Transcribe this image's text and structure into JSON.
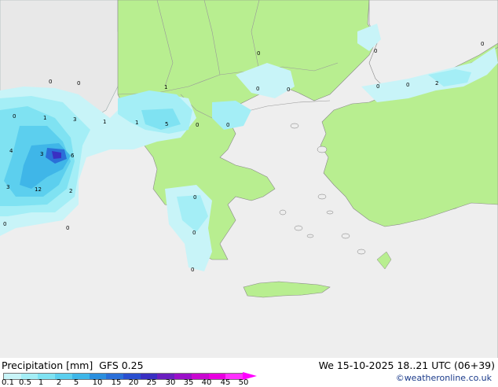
{
  "footer": {
    "title": "Precipitation [mm]  GFS 0.25",
    "valid_time": "We 15-10-2025 18..21 UTC (06+39)",
    "credit": "©weatheronline.co.uk"
  },
  "legend": {
    "labels": [
      "0.1",
      "0.5",
      "1",
      "2",
      "5",
      "10",
      "15",
      "20",
      "25",
      "30",
      "35",
      "40",
      "45",
      "50"
    ],
    "colors": [
      "#c8f4f8",
      "#a4eef6",
      "#7fe2f2",
      "#5ccfee",
      "#3fb6e8",
      "#2b8fde",
      "#2a6fd8",
      "#2a4fcf",
      "#3a2fc2",
      "#6a1fbf",
      "#9a10c8",
      "#c808d0",
      "#e800e0",
      "#ff30ff"
    ]
  },
  "map": {
    "land_color": "#b8ee90",
    "sea_color": "#eeeeee",
    "values": [
      "0",
      "0",
      "0",
      "1",
      "3",
      "1",
      "1",
      "5",
      "0",
      "0",
      "0",
      "0",
      "0",
      "0",
      "0",
      "0",
      "1",
      "2",
      "4",
      "3",
      "6",
      "3",
      "12",
      "2",
      "0",
      "0",
      "0",
      "0",
      "0",
      "0"
    ]
  }
}
